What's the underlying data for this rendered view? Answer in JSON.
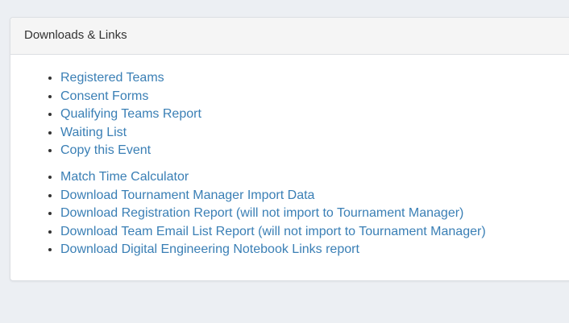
{
  "panel": {
    "title": "Downloads & Links"
  },
  "links_group_1": [
    "Registered Teams",
    "Consent Forms",
    "Qualifying Teams Report",
    "Waiting List",
    "Copy this Event"
  ],
  "links_group_2": [
    "Match Time Calculator",
    "Download Tournament Manager Import Data",
    "Download Registration Report (will not import to Tournament Manager)",
    "Download Team Email List Report (will not import to Tournament Manager)",
    "Download Digital Engineering Notebook Links report"
  ],
  "colors": {
    "link": "#3a7fb5",
    "page_background": "#eceff3",
    "heading_background": "#f5f5f5"
  }
}
